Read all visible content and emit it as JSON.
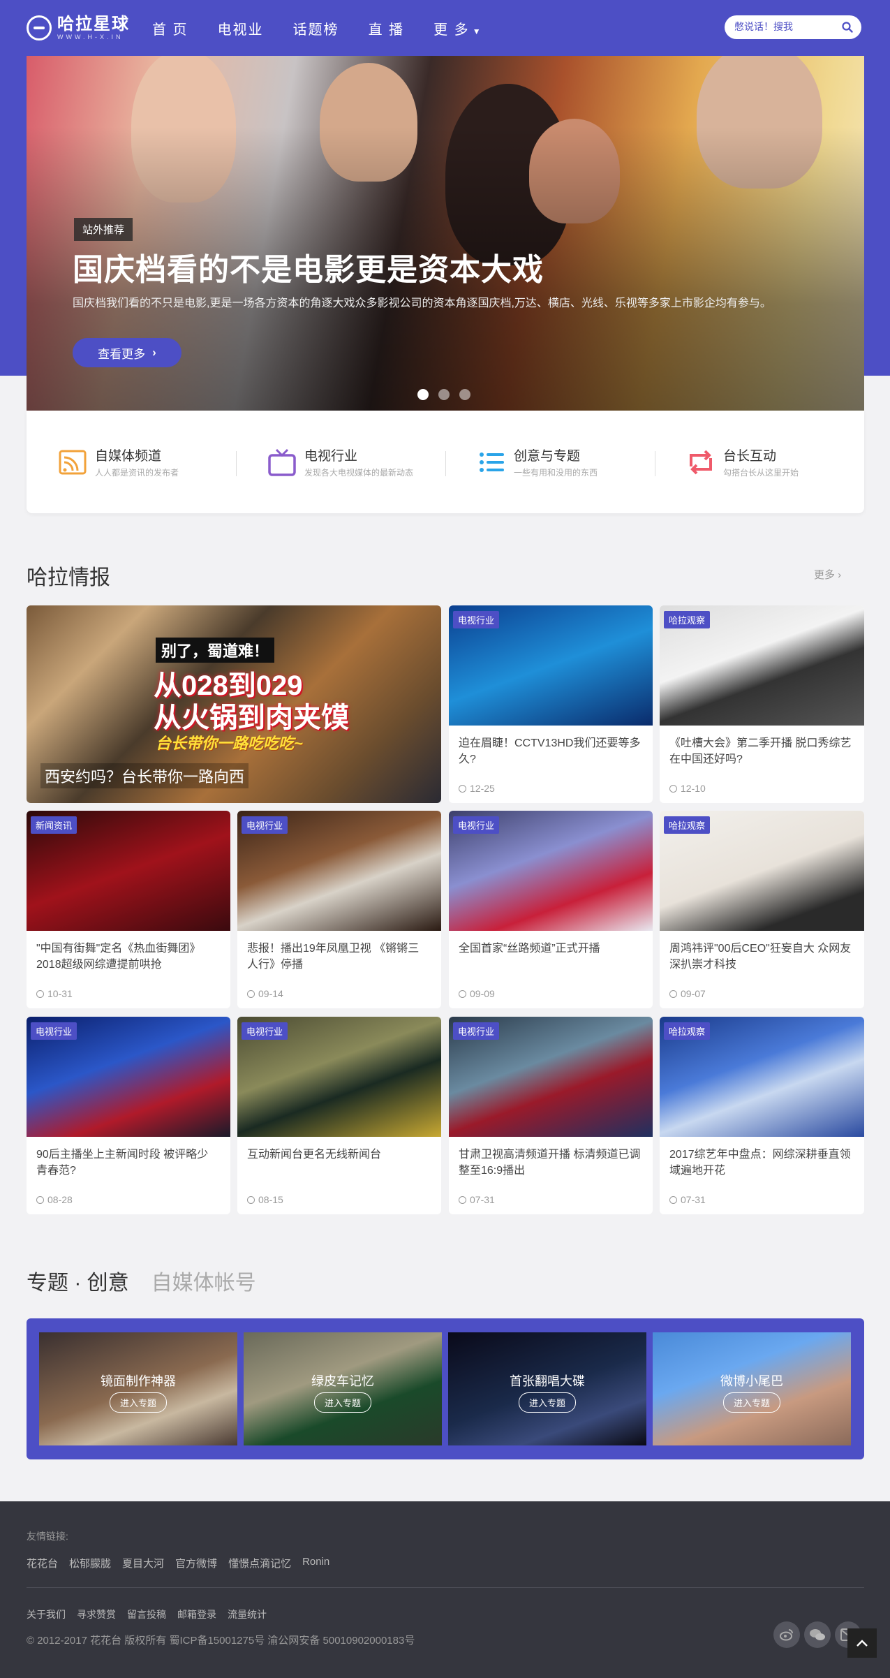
{
  "colors": {
    "brand": "#4d4fc5",
    "footer": "#35363e",
    "page_bg": "#f2f2f4"
  },
  "header": {
    "logo_cn": "哈拉星球",
    "logo_en": "WWW.H-X.IN",
    "nav": [
      "首 页",
      "电视业",
      "话题榜",
      "直 播",
      "更 多"
    ],
    "search_placeholder": "憋说话！搜我"
  },
  "banner": {
    "tag": "站外推荐",
    "title": "国庆档看的不是电影更是资本大戏",
    "desc": "国庆档我们看的不只是电影,更是一场各方资本的角逐大戏众多影视公司的资本角逐国庆档,万达、横店、光线、乐视等多家上市影企均有参与。",
    "button": "查看更多"
  },
  "features": [
    {
      "title": "自媒体频道",
      "sub": "人人都是资讯的发布者",
      "icon": "rss-icon",
      "color": "#f2a23a"
    },
    {
      "title": "电视行业",
      "sub": "发现各大电视媒体的最新动态",
      "icon": "tv-icon",
      "color": "#8a5ccc"
    },
    {
      "title": "创意与专题",
      "sub": "一些有用和没用的东西",
      "icon": "list-icon",
      "color": "#2aa4e8"
    },
    {
      "title": "台长互动",
      "sub": "勾搭台长从这里开始",
      "icon": "repeat-icon",
      "color": "#ef5a6a"
    }
  ],
  "news_section": {
    "title": "哈拉情报",
    "more": "更多 ›"
  },
  "big_news": {
    "l1": "别了，蜀道难！",
    "l2": "从028到029",
    "l3": "从火锅到肉夹馍",
    "l4": "台长带你一路吃吃吃~",
    "caption": "西安约吗？台长带你一路向西"
  },
  "news": [
    {
      "cat": "电视行业",
      "title": "迫在眉睫！CCTV13HD我们还要等多久?",
      "date": "12-25"
    },
    {
      "cat": "哈拉观察",
      "title": "《吐槽大会》第二季开播 脱口秀综艺在中国还好吗?",
      "date": "12-10"
    },
    {
      "cat": "新闻资讯",
      "title": "\"中国有街舞\"定名《热血街舞团》2018超级网综遭提前哄抢",
      "date": "10-31"
    },
    {
      "cat": "电视行业",
      "title": "悲报！播出19年凤凰卫视 《锵锵三人行》停播",
      "date": "09-14"
    },
    {
      "cat": "电视行业",
      "title": "全国首家“丝路频道”正式开播",
      "date": "09-09"
    },
    {
      "cat": "哈拉观察",
      "title": "周鸿祎评\"00后CEO\"狂妄自大 众网友深扒崇才科技",
      "date": "09-07"
    },
    {
      "cat": "电视行业",
      "title": "90后主播坐上主新闻时段 被评略少青春范?",
      "date": "08-28"
    },
    {
      "cat": "电视行业",
      "title": "互动新闻台更名无线新闻台",
      "date": "08-15"
    },
    {
      "cat": "电视行业",
      "title": "甘肃卫视高清频道开播 标清频道已调整至16:9播出",
      "date": "07-31"
    },
    {
      "cat": "哈拉观察",
      "title": "2017综艺年中盘点：网综深耕垂直领域遍地开花",
      "date": "07-31"
    }
  ],
  "topics": {
    "tabs": [
      "专题 · 创意",
      "自媒体帐号"
    ],
    "items": [
      {
        "title": "镜面制作神器",
        "button": "进入专题"
      },
      {
        "title": "绿皮车记忆",
        "button": "进入专题"
      },
      {
        "title": "首张翻唱大碟",
        "button": "进入专题"
      },
      {
        "title": "微博小尾巴",
        "button": "进入专题"
      }
    ]
  },
  "footer": {
    "friend_label": "友情链接:",
    "friend_links": [
      "花花台",
      "松郁朦胧",
      "夏目大河",
      "官方微博",
      "懂憬点滴记忆",
      "Ronin"
    ],
    "nav": [
      "关于我们",
      "寻求赞赏",
      "留言投稿",
      "邮箱登录",
      "流量统计"
    ],
    "copyright": "© 2012-2017  花花台 版权所有  蜀ICP备15001275号  渝公网安备 50010902000183号"
  }
}
